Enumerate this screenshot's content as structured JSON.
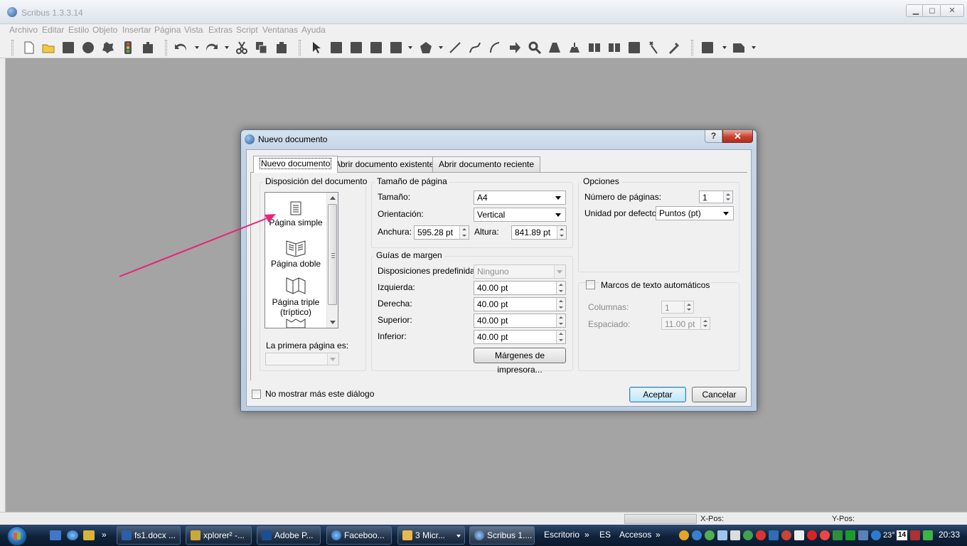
{
  "app": {
    "title": "Scribus 1.3.3.14",
    "window_controls": [
      "▁",
      "◻",
      "✕"
    ],
    "menu": [
      "Archivo",
      "Editar",
      "Estilo",
      "Objeto",
      "Insertar",
      "Página",
      "Vista",
      "Extras",
      "Script",
      "Ventanas",
      "Ayuda"
    ]
  },
  "statusbar": {
    "xpos_label": "X-Pos:",
    "ypos_label": "Y-Pos:"
  },
  "dialog": {
    "title": "Nuevo documento",
    "help_label": "?",
    "close_label": "✕",
    "tabs": [
      "Nuevo documento",
      "Abrir documento existente",
      "Abrir documento reciente"
    ],
    "layout": {
      "label": "Disposición del documento",
      "items": [
        "Página simple",
        "Página doble",
        "Página triple (tríptico)"
      ],
      "first_page_label": "La primera página es:",
      "first_page_value": ""
    },
    "page_size": {
      "label": "Tamaño de página",
      "size_label": "Tamaño:",
      "size_value": "A4",
      "orientation_label": "Orientación:",
      "orientation_value": "Vertical",
      "width_label": "Anchura:",
      "width_value": "595.28 pt",
      "height_label": "Altura:",
      "height_value": "841.89 pt"
    },
    "margins": {
      "label": "Guías de margen",
      "presets_label": "Disposiciones predefinidas:",
      "presets_value": "Ninguno",
      "left_label": "Izquierda:",
      "left_value": "40.00 pt",
      "right_label": "Derecha:",
      "right_value": "40.00 pt",
      "top_label": "Superior:",
      "top_value": "40.00 pt",
      "bottom_label": "Inferior:",
      "bottom_value": "40.00 pt",
      "printer_button": "Márgenes de impresora..."
    },
    "options": {
      "label": "Opciones",
      "pages_label": "Número de páginas:",
      "pages_value": "1",
      "unit_label": "Unidad por defecto:",
      "unit_value": "Puntos (pt)"
    },
    "text_frames": {
      "label": "Marcos de texto automáticos",
      "checked": false,
      "columns_label": "Columnas:",
      "columns_value": "1",
      "spacing_label": "Espaciado:",
      "spacing_value": "11.00 pt"
    },
    "dont_show_label": "No mostrar más este diálogo",
    "accept_button": "Aceptar",
    "cancel_button": "Cancelar"
  },
  "annotation_arrow_color": "#e8237a",
  "taskbar": {
    "quicklaunch_overflow": "»",
    "buttons": [
      "fs1.docx ...",
      "xplorer² -...",
      "Adobe P...",
      "Faceboo...",
      "3 Micr...",
      "Scribus 1...."
    ],
    "toolbars": [
      "Escritorio",
      "ES",
      "Accesos"
    ],
    "temperature": "23°",
    "calendar_day": "14",
    "clock": "20:33"
  }
}
